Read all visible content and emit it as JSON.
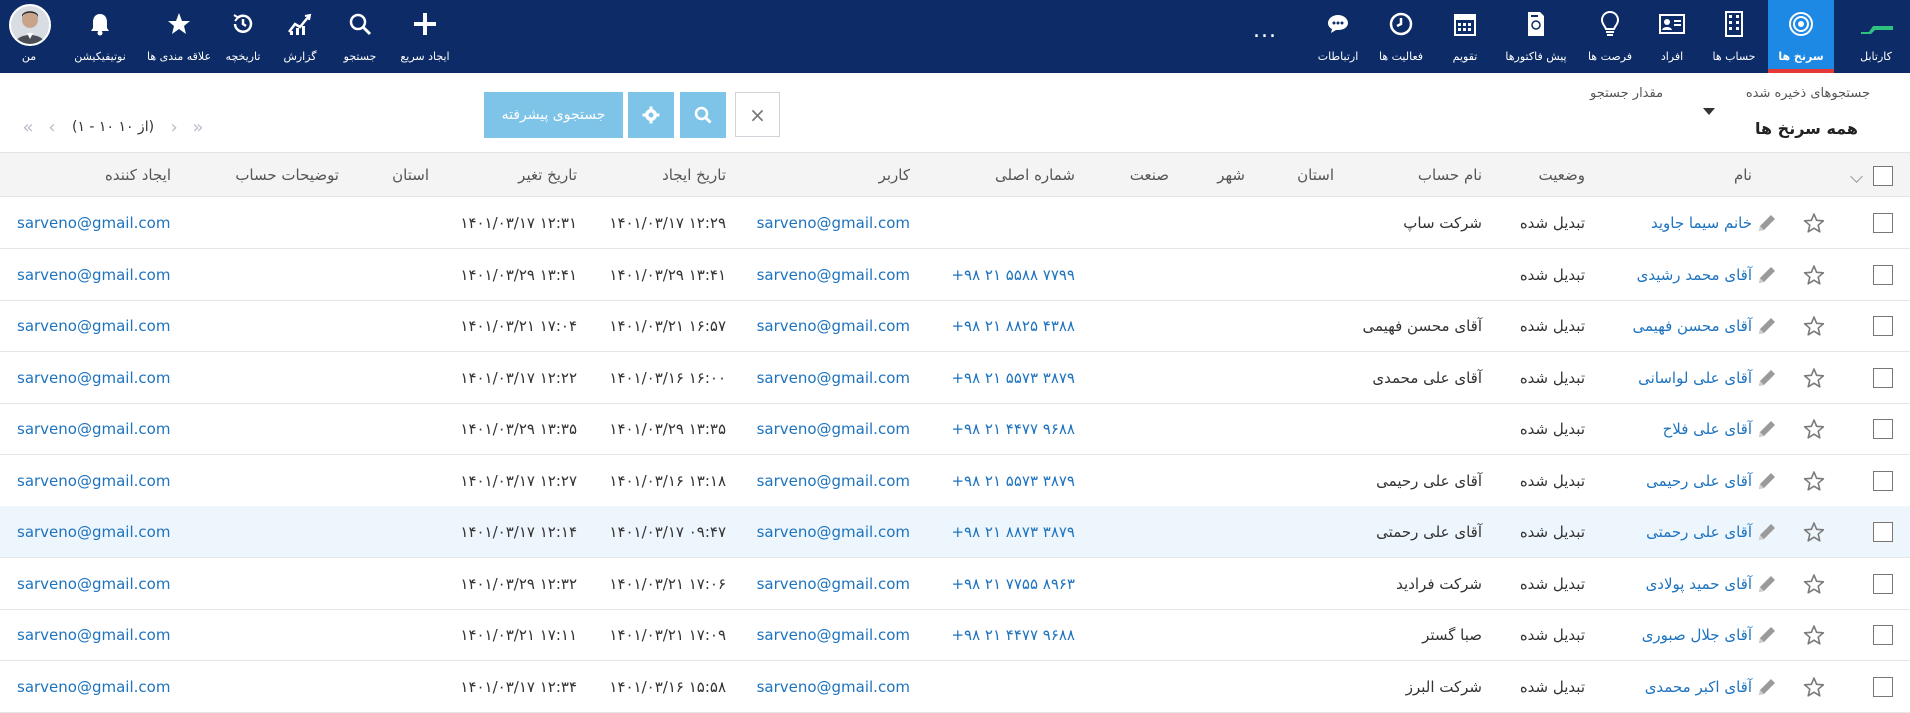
{
  "nav": {
    "brand_label": "کارتابل",
    "items_right": [
      {
        "label": "سرنخ ها",
        "icon": "target-icon",
        "active": true
      },
      {
        "label": "حساب ها",
        "icon": "building-icon"
      },
      {
        "label": "افراد",
        "icon": "contact-card-icon"
      },
      {
        "label": "فرصت ها",
        "icon": "lightbulb-icon"
      },
      {
        "label": "پیش فاکتورها",
        "icon": "invoice-icon"
      },
      {
        "label": "تقویم",
        "icon": "calendar-icon"
      },
      {
        "label": "فعالیت ها",
        "icon": "clock-icon"
      },
      {
        "label": "ارتباطات",
        "icon": "chat-icon"
      }
    ],
    "more_label": "...",
    "items_left": [
      {
        "label": "ایجاد سریع",
        "icon": "plus-icon"
      },
      {
        "label": "جستجو",
        "icon": "search-icon"
      },
      {
        "label": "گزارش",
        "icon": "chart-icon"
      },
      {
        "label": "تاریخچه",
        "icon": "history-icon"
      },
      {
        "label": "علاقه مندی ها",
        "icon": "star-icon"
      },
      {
        "label": "نوتیفیکیشن",
        "icon": "bell-icon"
      }
    ],
    "me_label": "من"
  },
  "toolbar": {
    "saved_searches_label": "جستجوهای ذخیره شده",
    "search_value_label": "مقدار جستجو",
    "view_title": "همه سرنخ ها",
    "clear_label": "×",
    "advanced_search_label": "جستجوی پیشرفته",
    "pager_text": "(۱ - ۱۰ از ۱۰)"
  },
  "table": {
    "columns": {
      "name": "نام",
      "status": "وضعیت",
      "account_name": "نام حساب",
      "province": "استان",
      "city": "شهر",
      "industry": "صنعت",
      "phone": "شماره اصلی",
      "user": "کاربر",
      "created": "تاریخ ایجاد",
      "modified": "تاریخ تغیر",
      "province2": "استان",
      "account_desc": "توضیحات حساب",
      "creator": "ایجاد کننده"
    },
    "rows": [
      {
        "name": "خانم سیما جاوید",
        "status": "تبدیل شده",
        "account": "شرکت ساپ",
        "phone": "",
        "user": "sarveno@gmail.com",
        "created": "۱۴۰۱/۰۳/۱۷ ۱۲:۲۹",
        "modified": "۱۴۰۱/۰۳/۱۷ ۱۲:۳۱",
        "creator": "sarveno@gmail.com"
      },
      {
        "name": "آقای محمد رشیدی",
        "status": "تبدیل شده",
        "account": "",
        "phone": "+۹۸ ۲۱ ۵۵۸۸ ۷۷۹۹",
        "user": "sarveno@gmail.com",
        "created": "۱۴۰۱/۰۳/۲۹ ۱۳:۴۱",
        "modified": "۱۴۰۱/۰۳/۲۹ ۱۳:۴۱",
        "creator": "sarveno@gmail.com"
      },
      {
        "name": "آقای محسن فهیمی",
        "status": "تبدیل شده",
        "account": "آقای محسن فهیمی",
        "phone": "+۹۸ ۲۱ ۸۸۲۵ ۴۳۸۸",
        "user": "sarveno@gmail.com",
        "created": "۱۴۰۱/۰۳/۲۱ ۱۶:۵۷",
        "modified": "۱۴۰۱/۰۳/۲۱ ۱۷:۰۴",
        "creator": "sarveno@gmail.com"
      },
      {
        "name": "آقای علی لواسانی",
        "status": "تبدیل شده",
        "account": "آقای علی محمدی",
        "phone": "+۹۸ ۲۱ ۵۵۷۳ ۳۸۷۹",
        "user": "sarveno@gmail.com",
        "created": "۱۴۰۱/۰۳/۱۶ ۱۶:۰۰",
        "modified": "۱۴۰۱/۰۳/۱۷ ۱۲:۲۲",
        "creator": "sarveno@gmail.com"
      },
      {
        "name": "آقای علی فلاح",
        "status": "تبدیل شده",
        "account": "",
        "phone": "+۹۸ ۲۱ ۴۴۷۷ ۹۶۸۸",
        "user": "sarveno@gmail.com",
        "created": "۱۴۰۱/۰۳/۲۹ ۱۳:۳۵",
        "modified": "۱۴۰۱/۰۳/۲۹ ۱۳:۳۵",
        "creator": "sarveno@gmail.com"
      },
      {
        "name": "آقای علی رحیمی",
        "status": "تبدیل شده",
        "account": "آقای علی رحیمی",
        "phone": "+۹۸ ۲۱ ۵۵۷۳ ۳۸۷۹",
        "user": "sarveno@gmail.com",
        "created": "۱۴۰۱/۰۳/۱۶ ۱۳:۱۸",
        "modified": "۱۴۰۱/۰۳/۱۷ ۱۲:۲۷",
        "creator": "sarveno@gmail.com"
      },
      {
        "name": "آقای علی رحمتی",
        "status": "تبدیل شده",
        "account": "آقای علی رحمتی",
        "phone": "+۹۸ ۲۱ ۸۸۷۳ ۳۸۷۹",
        "user": "sarveno@gmail.com",
        "created": "۱۴۰۱/۰۳/۱۷ ۰۹:۴۷",
        "modified": "۱۴۰۱/۰۳/۱۷ ۱۲:۱۴",
        "creator": "sarveno@gmail.com",
        "highlight": true
      },
      {
        "name": "آقای حمید پولادی",
        "status": "تبدیل شده",
        "account": "شرکت فرادید",
        "phone": "+۹۸ ۲۱ ۷۷۵۵ ۸۹۶۳",
        "user": "sarveno@gmail.com",
        "created": "۱۴۰۱/۰۳/۲۱ ۱۷:۰۶",
        "modified": "۱۴۰۱/۰۳/۲۹ ۱۲:۳۲",
        "creator": "sarveno@gmail.com"
      },
      {
        "name": "آقای جلال صبوری",
        "status": "تبدیل شده",
        "account": "صبا گستر",
        "phone": "+۹۸ ۲۱ ۴۴۷۷ ۹۶۸۸",
        "user": "sarveno@gmail.com",
        "created": "۱۴۰۱/۰۳/۲۱ ۱۷:۰۹",
        "modified": "۱۴۰۱/۰۳/۲۱ ۱۷:۱۱",
        "creator": "sarveno@gmail.com"
      },
      {
        "name": "آقای اکبر محمدی",
        "status": "تبدیل شده",
        "account": "شرکت البرز",
        "phone": "",
        "user": "sarveno@gmail.com",
        "created": "۱۴۰۱/۰۳/۱۶ ۱۵:۵۸",
        "modified": "۱۴۰۱/۰۳/۱۷ ۱۲:۳۴",
        "creator": "sarveno@gmail.com"
      }
    ]
  },
  "colors": {
    "nav_bg": "#0d2b66",
    "nav_active": "#1e88e5",
    "link": "#1e73be",
    "button": "#7ec4e8"
  }
}
